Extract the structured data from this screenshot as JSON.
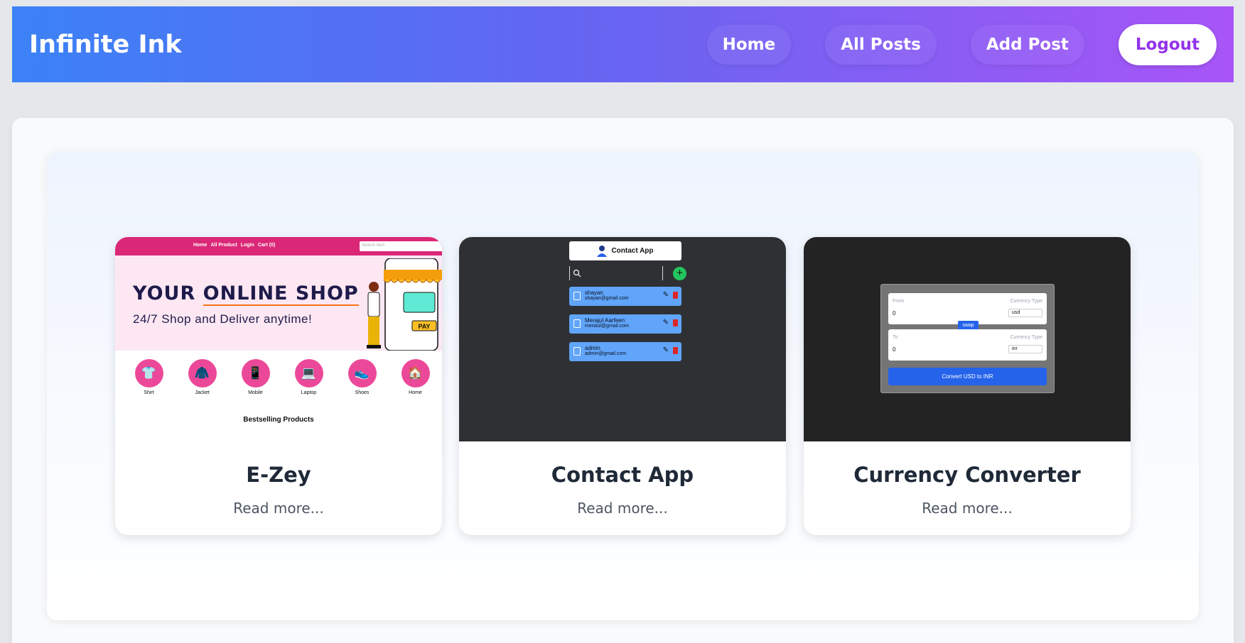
{
  "header": {
    "brand": "Infinite Ink",
    "nav": {
      "home": "Home",
      "all_posts": "All Posts",
      "add_post": "Add Post",
      "logout": "Logout"
    }
  },
  "cards": [
    {
      "title": "E-Zey",
      "read_more": "Read more...",
      "thumb": {
        "nav": [
          "Home",
          "All Product",
          "Login",
          "Cart (0)"
        ],
        "search_placeholder": "Search Item",
        "headline_a": "YOUR ",
        "headline_b": "ONLINE SHOP",
        "subline": "24/7 Shop and Deliver anytime!",
        "categories": [
          "Shirt",
          "Jacket",
          "Mobile",
          "Laptop",
          "Shoes",
          "Home"
        ],
        "section": "Bestselling Products"
      }
    },
    {
      "title": "Contact App",
      "read_more": "Read more...",
      "thumb": {
        "header": "Contact App",
        "contacts": [
          {
            "name": "shayan",
            "email": "shayan@gmail.com"
          },
          {
            "name": "Merajul Aarfeen",
            "email": "meraiul@gmail.com"
          },
          {
            "name": "admin",
            "email": "admin@gmail.com"
          }
        ]
      }
    },
    {
      "title": "Currency Converter",
      "read_more": "Read more...",
      "thumb": {
        "from_label": "From",
        "to_label": "To",
        "type_label": "Currency Type",
        "from_value": "0",
        "to_value": "0",
        "from_currency": "usd",
        "to_currency": "inr",
        "swap": "swap",
        "convert": "Convert USD to INR"
      }
    }
  ]
}
